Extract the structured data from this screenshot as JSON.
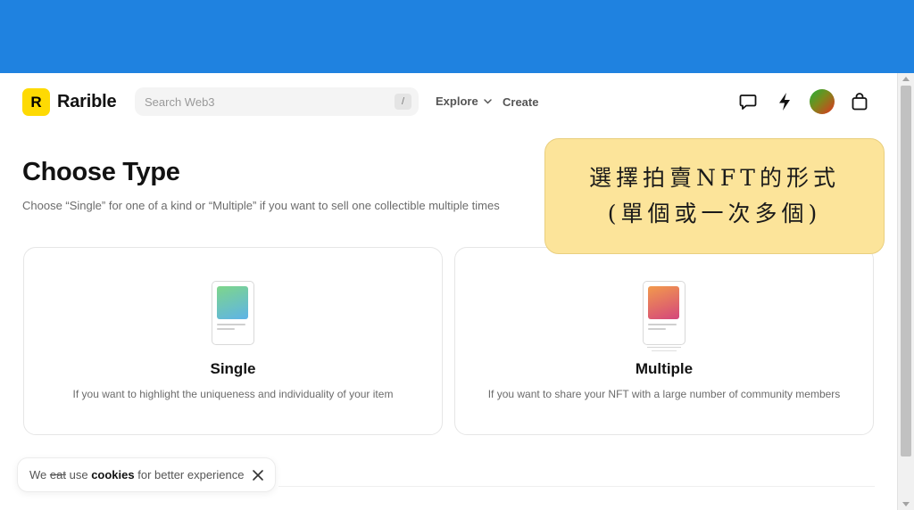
{
  "colors": {
    "top_band": "#1f82e0",
    "brand_yellow": "#feda03",
    "callout_bg": "#fce49a",
    "single_gradient": [
      "#7bd58f",
      "#5fb5e6"
    ],
    "multiple_gradient": [
      "#f2944e",
      "#d24a7a"
    ]
  },
  "header": {
    "logo_mark": "R",
    "logo_text": "Rarible",
    "search": {
      "placeholder": "Search Web3",
      "shortcut": "/"
    },
    "nav": {
      "explore": "Explore",
      "create": "Create"
    },
    "icons": [
      "chat-bubble-icon",
      "lightning-icon",
      "avatar",
      "shopping-bag-icon"
    ]
  },
  "main": {
    "title": "Choose Type",
    "subtitle": "Choose “Single” for one of a kind or “Multiple” if you want to sell one collectible multiple times",
    "cards": [
      {
        "title": "Single",
        "description": "If you want to highlight the uniqueness and individuality of your item"
      },
      {
        "title": "Multiple",
        "description": "If you want to share your NFT with a large number of community members"
      }
    ]
  },
  "callout": {
    "line1": "選擇拍賣NFT的形式",
    "line2": "(單個或一次多個)"
  },
  "cookie_banner": {
    "we": "We",
    "struck": "eat",
    "use": "use",
    "cookies": "cookies",
    "rest": "for better experience"
  }
}
